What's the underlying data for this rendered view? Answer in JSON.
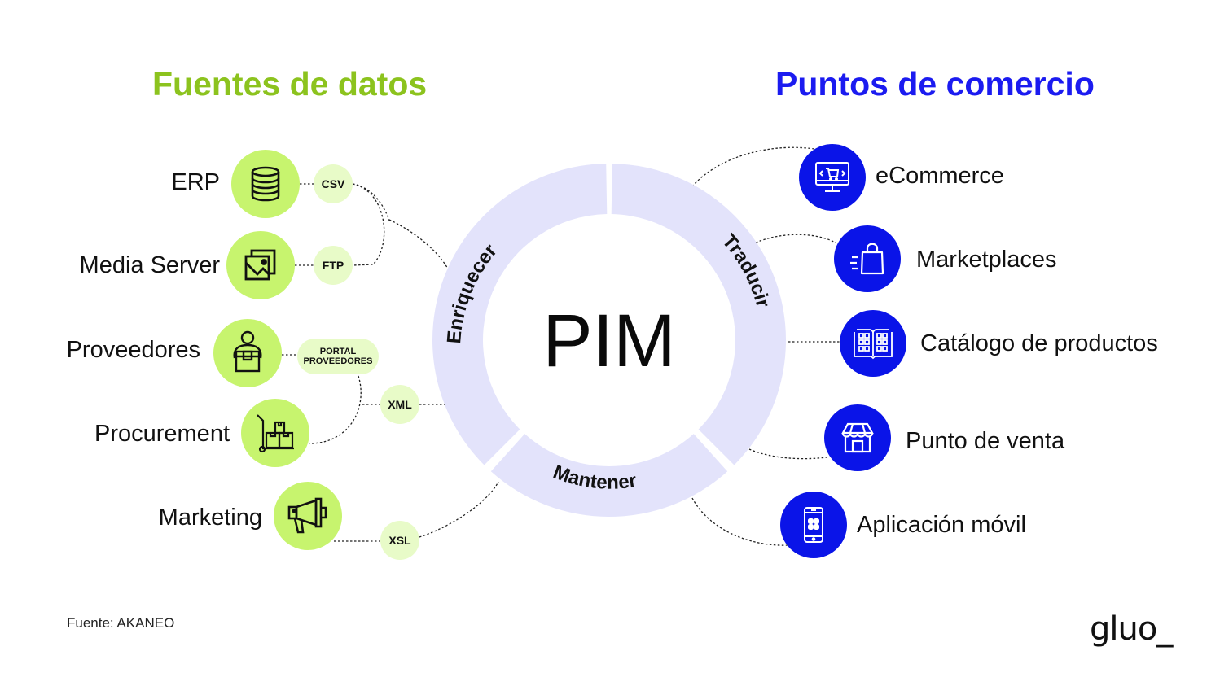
{
  "headings": {
    "sources": "Fuentes de datos",
    "commerce": "Puntos de comercio"
  },
  "colors": {
    "sources_accent": "#8cc31e",
    "source_circle": "#c7f46e",
    "format_bubble": "#e8fbc8",
    "commerce_accent": "#1b1bf0",
    "commerce_circle": "#0a14e8",
    "ring": "#e3e3fb"
  },
  "center": {
    "title": "PIM",
    "segments": [
      "Enriquecer",
      "Traducir",
      "Mantener"
    ]
  },
  "sources": [
    {
      "label": "ERP",
      "icon": "database-icon"
    },
    {
      "label": "Media Server",
      "icon": "image-gallery-icon"
    },
    {
      "label": "Proveedores",
      "icon": "person-with-box-icon"
    },
    {
      "label": "Procurement",
      "icon": "hand-truck-boxes-icon"
    },
    {
      "label": "Marketing",
      "icon": "megaphone-icon"
    }
  ],
  "formats": {
    "csv": "CSV",
    "ftp": "FTP",
    "portal_line1": "PORTAL",
    "portal_line2": "PROVEEDORES",
    "xml": "XML",
    "xsl": "XSL"
  },
  "commerce_points": [
    {
      "label": "eCommerce",
      "icon": "monitor-cart-icon"
    },
    {
      "label": "Marketplaces",
      "icon": "shopping-bag-icon"
    },
    {
      "label": "Catálogo de productos",
      "icon": "open-catalog-icon"
    },
    {
      "label": "Punto de venta",
      "icon": "storefront-icon"
    },
    {
      "label": "Aplicación móvil",
      "icon": "smartphone-apps-icon"
    }
  ],
  "footer": {
    "source_note": "Fuente: AKANEO",
    "logo": "gluo_"
  }
}
